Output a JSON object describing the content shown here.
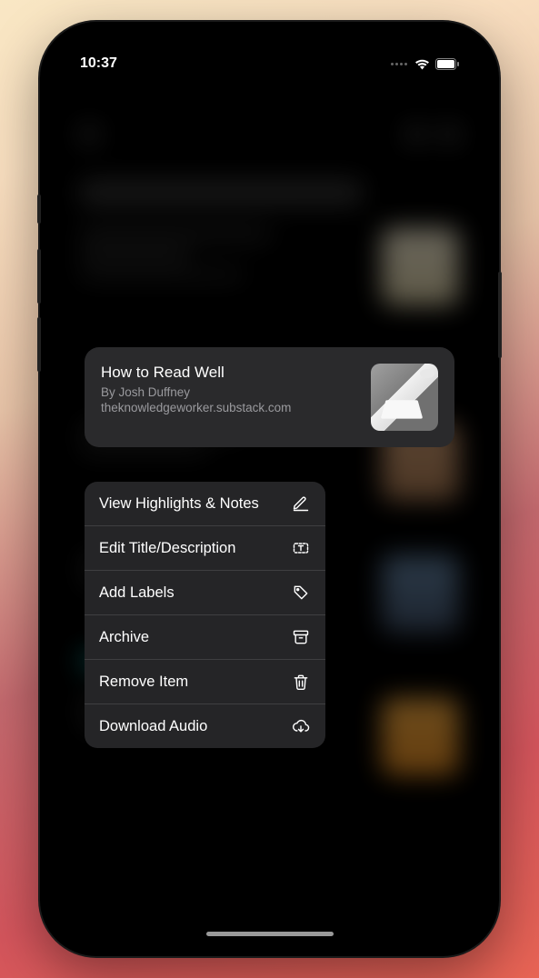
{
  "status": {
    "time": "10:37"
  },
  "preview": {
    "title": "How to Read Well",
    "author": "By Josh Duffney",
    "source": "theknowledgeworker.substack.com"
  },
  "menu": {
    "items": [
      {
        "label": "View Highlights & Notes"
      },
      {
        "label": "Edit Title/Description"
      },
      {
        "label": "Add Labels"
      },
      {
        "label": "Archive"
      },
      {
        "label": "Remove Item"
      },
      {
        "label": "Download Audio"
      }
    ]
  }
}
